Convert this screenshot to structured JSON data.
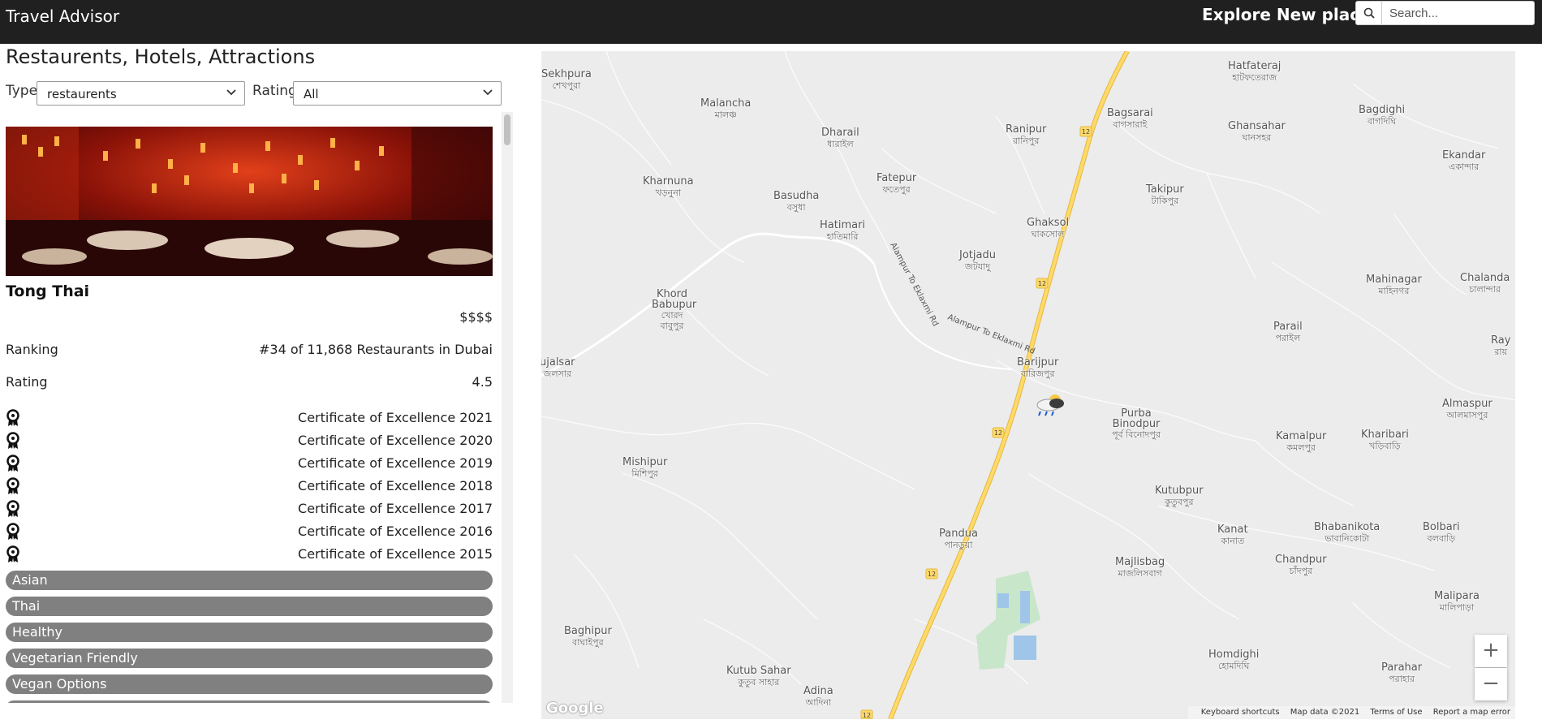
{
  "app": {
    "title": "Travel Advisor",
    "explore_label": "Explore New place",
    "search": {
      "placeholder": "Search...",
      "value": ""
    }
  },
  "list": {
    "heading": "Restaurents, Hotels, Attractions",
    "filters": {
      "type_label": "Type",
      "type_value": "restaurents",
      "rating_label": "Rating",
      "rating_value": "All"
    }
  },
  "place_card": {
    "name": "Tong Thai",
    "price_level": "$$$$",
    "ranking_label": "Ranking",
    "ranking_value": "#34 of 11,868 Restaurants in Dubai",
    "rating_label": "Rating",
    "rating_value": "4.5",
    "awards": [
      "Certificate of Excellence 2021",
      "Certificate of Excellence 2020",
      "Certificate of Excellence 2019",
      "Certificate of Excellence 2018",
      "Certificate of Excellence 2017",
      "Certificate of Excellence 2016",
      "Certificate of Excellence 2015"
    ],
    "cuisines": [
      "Asian",
      "Thai",
      "Healthy",
      "Vegetarian Friendly",
      "Vegan Options"
    ]
  },
  "map": {
    "places": [
      {
        "en": "Sekhpura",
        "bn": "শেখপুরা"
      },
      {
        "en": "Malancha",
        "bn": "মালঞ্চ"
      },
      {
        "en": "Dharail",
        "bn": "ধারাইল"
      },
      {
        "en": "Ranipur",
        "bn": "রানিপুর"
      },
      {
        "en": "Bagsarai",
        "bn": "বাগসারাই"
      },
      {
        "en": "Hatfateraj",
        "bn": "হাটফতেরাজ"
      },
      {
        "en": "Ghansahar",
        "bn": "ঘানসহর"
      },
      {
        "en": "Bagdighi",
        "bn": "বাগদিঘি"
      },
      {
        "en": "Ekandar",
        "bn": "একান্দার"
      },
      {
        "en": "Kharnuna",
        "bn": "খড়নুনা"
      },
      {
        "en": "Basudha",
        "bn": "বসুধা"
      },
      {
        "en": "Fatepur",
        "bn": "ফতেপুর"
      },
      {
        "en": "Takipur",
        "bn": "টাকিপুর"
      },
      {
        "en": "Hatimari",
        "bn": "হাতিমারি"
      },
      {
        "en": "Ghaksol",
        "bn": "ঘাকসোল"
      },
      {
        "en": "Jotjadu",
        "bn": "জটযাদু"
      },
      {
        "en": "Mahinagar",
        "bn": "মাহিনগর"
      },
      {
        "en": "Chalanda",
        "bn": "চালান্দার"
      },
      {
        "en": "Khord Babupur",
        "bn": "খোরদ বাবুপুর"
      },
      {
        "en": "Parail",
        "bn": "পরাইল"
      },
      {
        "en": "Ray",
        "bn": "রায়"
      },
      {
        "en": "Barijpur",
        "bn": "বারিজপুর"
      },
      {
        "en": "ujalsar",
        "bn": "জলসার"
      },
      {
        "en": "Purba Binodpur",
        "bn": "পূর্ব বিনোদপুর"
      },
      {
        "en": "Kamalpur",
        "bn": "কমলপুর"
      },
      {
        "en": "Kharibari",
        "bn": "খড়িবাড়ি"
      },
      {
        "en": "Almaspur",
        "bn": "আলমাসপুর"
      },
      {
        "en": "Mishipur",
        "bn": "মিশিপুর"
      },
      {
        "en": "Kutubpur",
        "bn": "কুতুবপুর"
      },
      {
        "en": "Pandua",
        "bn": "পানডুয়া"
      },
      {
        "en": "Kanat",
        "bn": "কানাত"
      },
      {
        "en": "Bhabanikota",
        "bn": "ভাবানিকোটা"
      },
      {
        "en": "Bolbari",
        "bn": "বলবাড়ি"
      },
      {
        "en": "Majlisbag",
        "bn": "মাজলিসবাগ"
      },
      {
        "en": "Chandpur",
        "bn": "চাঁদপুর"
      },
      {
        "en": "Malipara",
        "bn": "মালিপাড়া"
      },
      {
        "en": "Baghipur",
        "bn": "বাঘাইপুর"
      },
      {
        "en": "Homdighi",
        "bn": "হোমদিঘি"
      },
      {
        "en": "Parahar",
        "bn": "পরাহার"
      },
      {
        "en": "Kutub Sahar",
        "bn": "কুতুব সাহার"
      },
      {
        "en": "Adina",
        "bn": "আদিনা"
      }
    ],
    "road_label": "Alampur To Eklaxmi Rd",
    "highway_shield": "12",
    "zoom_in": "+",
    "zoom_out": "−",
    "google": "Google",
    "footer": {
      "shortcuts": "Keyboard shortcuts",
      "data": "Map data ©2021",
      "terms": "Terms of Use",
      "report": "Report a map error"
    }
  }
}
